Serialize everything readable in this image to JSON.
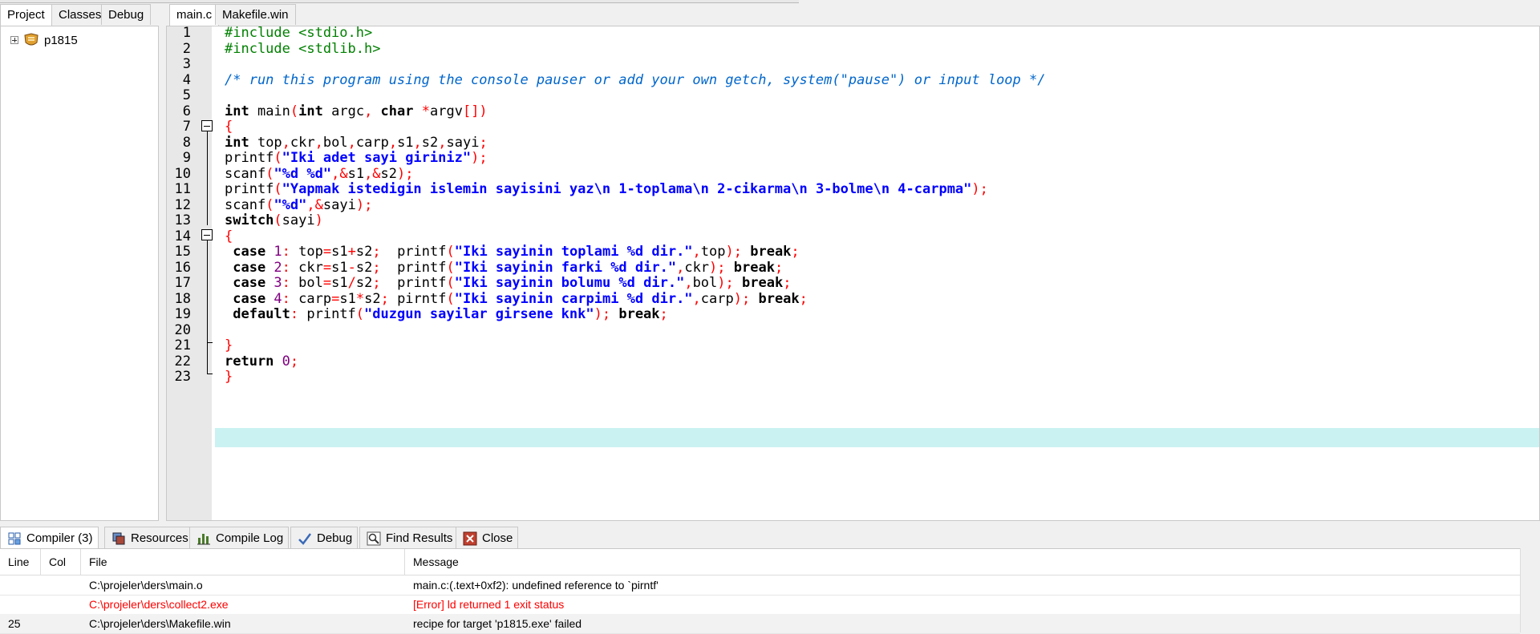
{
  "left_tabs": [
    "Project",
    "Classes",
    "Debug"
  ],
  "project_tree": {
    "name": "p1815"
  },
  "editor_tabs": [
    "main.c",
    "Makefile.win"
  ],
  "editor": {
    "current_line": 22,
    "lines": [
      "1",
      "2",
      "3",
      "4",
      "5",
      "6",
      "7",
      "8",
      "9",
      "10",
      "11",
      "12",
      "13",
      "14",
      "15",
      "16",
      "17",
      "18",
      "19",
      "20",
      "21",
      "22",
      "23"
    ],
    "code": {
      "l1_a": "#include <stdio.h>",
      "l2_a": "#include <stdlib.h>",
      "l4_a": "/* run this program using the console pauser or add your own getch, system(\"pause\") or input loop */",
      "l6_kw1": "int",
      "l6_a": " main",
      "l6_p1": "(",
      "l6_kw2": "int",
      "l6_b": " argc",
      "l6_c": ", ",
      "l6_kw3": "char",
      "l6_d": " ",
      "l6_star": "*",
      "l6_e": "argv",
      "l6_br": "[])",
      "l7": "{",
      "l8_kw": "int",
      "l8_a": " top",
      "l8_c1": ",",
      "l8_b": "ckr",
      "l8_c2": ",",
      "l8_c": "bol",
      "l8_c3": ",",
      "l8_d": "carp",
      "l8_c4": ",",
      "l8_e": "s1",
      "l8_c5": ",",
      "l8_f": "s2",
      "l8_c6": ",",
      "l8_g": "sayi",
      "l8_sc": ";",
      "l9_a": "printf",
      "l9_p": "(",
      "l9_s": "\"Iki adet sayi giriniz\"",
      "l9_e": ");",
      "l10_a": "scanf",
      "l10_p": "(",
      "l10_s": "\"%d %d\"",
      "l10_c": ",&",
      "l10_b": "s1",
      "l10_c2": ",&",
      "l10_d": "s2",
      "l10_e": ");",
      "l11_a": "printf",
      "l11_p": "(",
      "l11_s": "\"Yapmak istedigin islemin sayisini yaz\\n 1-toplama\\n 2-cikarma\\n 3-bolme\\n 4-carpma\"",
      "l11_e": ");",
      "l12_a": "scanf",
      "l12_p": "(",
      "l12_s": "\"%d\"",
      "l12_c": ",&",
      "l12_b": "sayi",
      "l12_e": ");",
      "l13_kw": "switch",
      "l13_p": "(",
      "l13_a": "sayi",
      "l13_e": ")",
      "l14": "{",
      "l15_kw": " case",
      "l15_n": " 1",
      "l15_c": ":",
      "l15_a": " top",
      "l15_eq": "=",
      "l15_b": "s1",
      "l15_op": "+",
      "l15_d": "s2",
      "l15_sc": ";",
      "l15_f": "  printf",
      "l15_p": "(",
      "l15_s": "\"Iki sayinin toplami %d dir.\"",
      "l15_cm": ",",
      "l15_g": "top",
      "l15_e": ");",
      "l15_brk": " break",
      "l15_sc2": ";",
      "l16_kw": " case",
      "l16_n": " 2",
      "l16_c": ":",
      "l16_a": " ckr",
      "l16_eq": "=",
      "l16_b": "s1",
      "l16_op": "-",
      "l16_d": "s2",
      "l16_sc": ";",
      "l16_f": "  printf",
      "l16_p": "(",
      "l16_s": "\"Iki sayinin farki %d dir.\"",
      "l16_cm": ",",
      "l16_g": "ckr",
      "l16_e": ");",
      "l16_brk": " break",
      "l16_sc2": ";",
      "l17_kw": " case",
      "l17_n": " 3",
      "l17_c": ":",
      "l17_a": " bol",
      "l17_eq": "=",
      "l17_b": "s1",
      "l17_op": "/",
      "l17_d": "s2",
      "l17_sc": ";",
      "l17_f": "  printf",
      "l17_p": "(",
      "l17_s": "\"Iki sayinin bolumu %d dir.\"",
      "l17_cm": ",",
      "l17_g": "bol",
      "l17_e": ");",
      "l17_brk": " break",
      "l17_sc2": ";",
      "l18_kw": " case",
      "l18_n": " 4",
      "l18_c": ":",
      "l18_a": " carp",
      "l18_eq": "=",
      "l18_b": "s1",
      "l18_op": "*",
      "l18_d": "s2",
      "l18_sc": ";",
      "l18_f": " pirntf",
      "l18_p": "(",
      "l18_s": "\"Iki sayinin carpimi %d dir.\"",
      "l18_cm": ",",
      "l18_g": "carp",
      "l18_e": ");",
      "l18_brk": " break",
      "l18_sc2": ";",
      "l19_kw": " default",
      "l19_c": ":",
      "l19_f": " printf",
      "l19_p": "(",
      "l19_s": "\"duzgun sayilar girsene knk\"",
      "l19_e": ");",
      "l19_brk": " break",
      "l19_sc2": ";",
      "l21": "}",
      "l22_kw": "return",
      "l22_n": " 0",
      "l22_sc": ";",
      "l23": "}"
    }
  },
  "bottom_tabs": [
    "Compiler (3)",
    "Resources",
    "Compile Log",
    "Debug",
    "Find Results",
    "Close"
  ],
  "results": {
    "columns": [
      "Line",
      "Col",
      "File",
      "Message"
    ],
    "rows": [
      {
        "line": "",
        "col": "",
        "file": "C:\\projeler\\ders\\main.o",
        "message": "main.c:(.text+0xf2): undefined reference to `pirntf'",
        "error": false
      },
      {
        "line": "",
        "col": "",
        "file": "C:\\projeler\\ders\\collect2.exe",
        "message": "[Error] ld returned 1 exit status",
        "error": true
      },
      {
        "line": "25",
        "col": "",
        "file": "C:\\projeler\\ders\\Makefile.win",
        "message": "recipe for target 'p1815.exe' failed",
        "error": false
      }
    ]
  },
  "colors": {
    "keyword": "#000000",
    "preprocessor": "#008000",
    "comment": "#0066cc",
    "string": "#0000ff",
    "symbol": "#ff0000",
    "number": "#800080",
    "current_line": "#cbf2f2",
    "error_text": "#ff0000"
  },
  "icons": {
    "project": "project-node-icon",
    "compiler": "compiler-grid-icon",
    "resources": "resources-icon",
    "compile_log": "bar-chart-icon",
    "debug": "checkmark-icon",
    "find": "find-icon",
    "close": "close-icon"
  }
}
